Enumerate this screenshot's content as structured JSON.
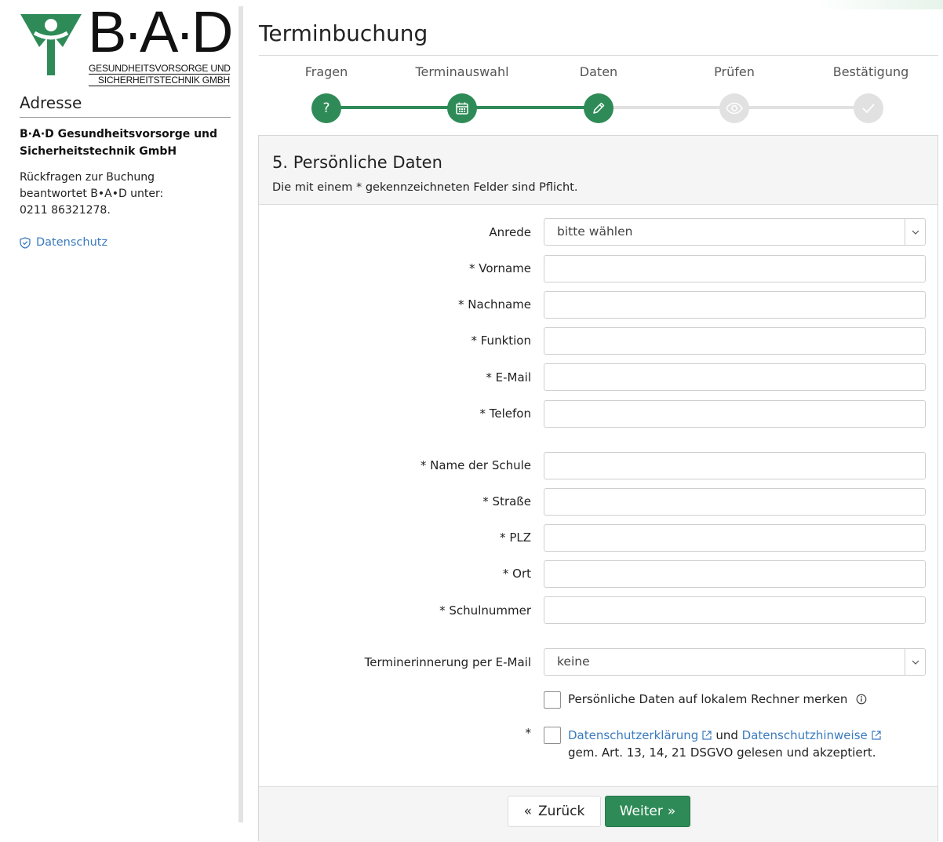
{
  "sidebar": {
    "logo": {
      "text": "B·A·D",
      "sub_line1": "GESUNDHEITSVORSORGE UND",
      "sub_line2": "SICHERHEITSTECHNIK GMBH"
    },
    "heading": "Adresse",
    "company_line1": "B·A·D Gesundheitsvorsorge und",
    "company_line2": "Sicherheitstechnik GmbH",
    "contact_line1": "Rückfragen zur Buchung",
    "contact_line2": "beantwortet B•A•D unter:",
    "contact_line3": "0211 86321278.",
    "privacy_link": "Datenschutz"
  },
  "main": {
    "title": "Terminbuchung",
    "steps": [
      {
        "label": "Fragen",
        "state": "done",
        "icon": "question-icon"
      },
      {
        "label": "Terminauswahl",
        "state": "done",
        "icon": "calendar-icon"
      },
      {
        "label": "Daten",
        "state": "current",
        "icon": "pencil-icon"
      },
      {
        "label": "Prüfen",
        "state": "pending",
        "icon": "eye-icon"
      },
      {
        "label": "Bestätigung",
        "state": "pending",
        "icon": "check-icon"
      }
    ],
    "colors": {
      "accent": "#2e8b57",
      "pending": "#e1e1e1",
      "link": "#3a7bbf"
    }
  },
  "form": {
    "title": "5. Persönliche Daten",
    "note": "Die mit einem * gekennzeichneten Felder sind Pflicht.",
    "anrede": {
      "label": "Anrede",
      "value": "bitte wählen"
    },
    "fields": [
      {
        "label": "* Vorname",
        "value": ""
      },
      {
        "label": "* Nachname",
        "value": ""
      },
      {
        "label": "* Funktion",
        "value": ""
      },
      {
        "label": "* E-Mail",
        "value": ""
      },
      {
        "label": "* Telefon",
        "value": ""
      },
      {
        "label": "* Name der Schule",
        "value": ""
      },
      {
        "label": "* Straße",
        "value": ""
      },
      {
        "label": "* PLZ",
        "value": ""
      },
      {
        "label": "* Ort",
        "value": ""
      },
      {
        "label": "* Schulnummer",
        "value": ""
      }
    ],
    "reminder": {
      "label": "Terminerinnerung per E-Mail",
      "value": "keine"
    },
    "remember_checkbox": {
      "label": "Persönliche Daten auf lokalem Rechner merken",
      "checked": false
    },
    "privacy_checkbox": {
      "required_mark": "*",
      "link1": "Datenschutzerklärung",
      "conjunction": "und",
      "link2": "Datenschutzhinweise",
      "line2": "gem. Art. 13, 14, 21 DSGVO gelesen und akzeptiert.",
      "checked": false
    },
    "buttons": {
      "back": "Zurück",
      "back_glyph": "«",
      "next": "Weiter",
      "next_glyph": "»"
    }
  }
}
